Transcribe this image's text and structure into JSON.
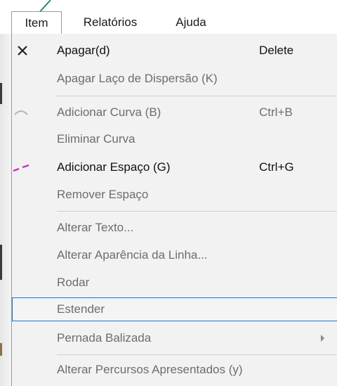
{
  "menubar": {
    "items": [
      {
        "label": "Item"
      },
      {
        "label": "Relatórios"
      },
      {
        "label": "Ajuda"
      }
    ]
  },
  "dropdown": {
    "items": [
      {
        "label": "Apagar(d)",
        "shortcut": "Delete",
        "icon": "close-icon"
      },
      {
        "label": "Apagar Laço de Dispersão (K)"
      },
      {
        "label": "Adicionar Curva (B)",
        "shortcut": "Ctrl+B",
        "icon": "curve-icon"
      },
      {
        "label": "Eliminar Curva"
      },
      {
        "label": "Adicionar Espaço (G)",
        "shortcut": "Ctrl+G",
        "icon": "dashed-line-icon"
      },
      {
        "label": "Remover Espaço"
      },
      {
        "label": "Alterar Texto..."
      },
      {
        "label": "Alterar Aparência da Linha..."
      },
      {
        "label": "Rodar"
      },
      {
        "label": "Estender"
      },
      {
        "label": "Pernada Balizada"
      },
      {
        "label": "Alterar Percursos Apresentados (y)"
      }
    ]
  },
  "colors": {
    "highlight_border": "#1a73d9",
    "gap_icon": "#c832c8",
    "pointer_line": "#2e8b57"
  }
}
